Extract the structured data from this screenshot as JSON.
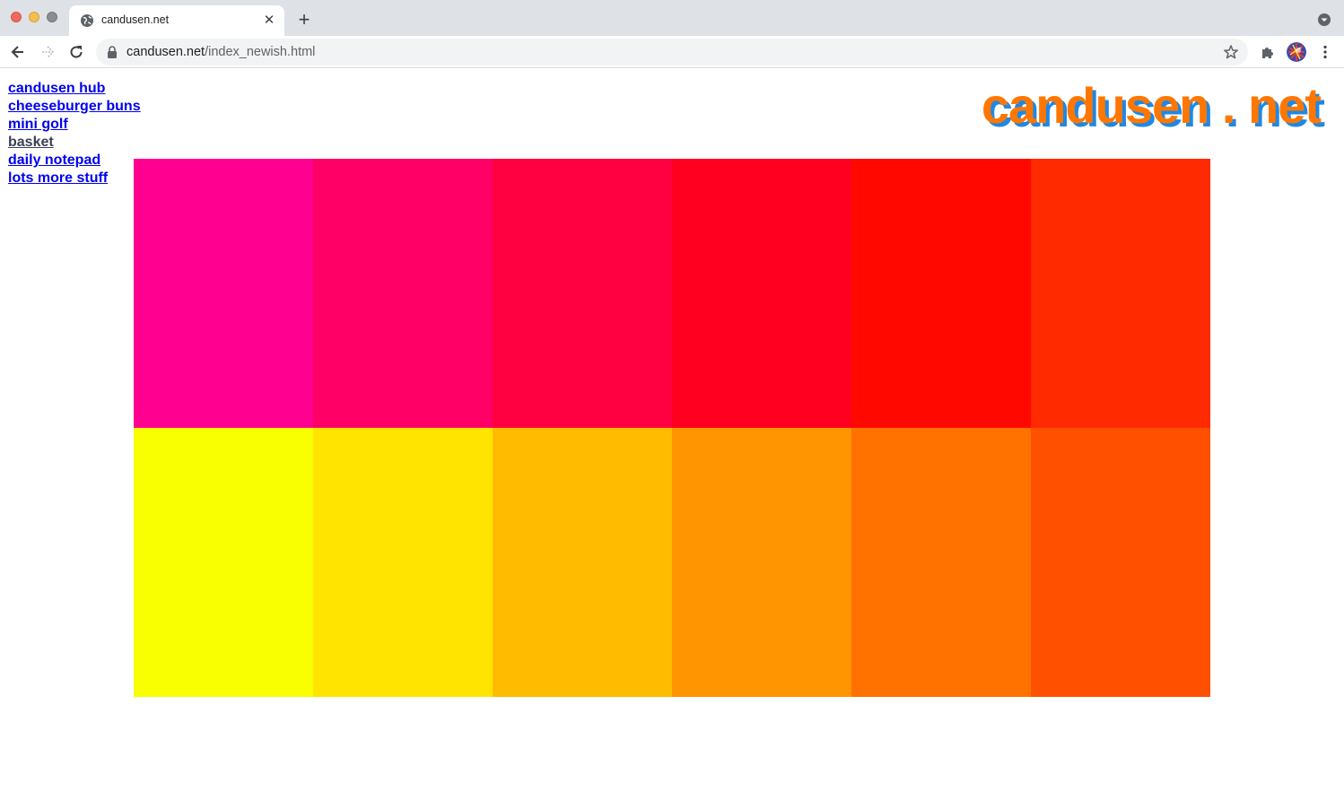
{
  "browser": {
    "tab": {
      "title": "candusen.net",
      "favicon": "globe-icon"
    },
    "new_tab_label": "+",
    "close_label": "✕",
    "url_host": "candusen.net",
    "url_path": "/index_newish.html"
  },
  "page": {
    "nav_links": [
      {
        "label": "candusen hub",
        "visited": false
      },
      {
        "label": "cheeseburger buns",
        "visited": false
      },
      {
        "label": "mini golf",
        "visited": false
      },
      {
        "label": "basket",
        "visited": true
      },
      {
        "label": "daily notepad",
        "visited": false
      },
      {
        "label": "lots more stuff",
        "visited": false
      }
    ],
    "logo_text": "candusen . net",
    "logo_colors": {
      "fill": "#ff7700",
      "shadow": "#1e88e5"
    },
    "color_grid": {
      "rows": [
        [
          "#ff0090",
          "#ff0066",
          "#ff0040",
          "#ff0020",
          "#ff0800",
          "#ff2a00"
        ],
        [
          "#f9ff00",
          "#ffe400",
          "#ffbb00",
          "#ff9500",
          "#ff7200",
          "#ff5000"
        ]
      ]
    }
  }
}
